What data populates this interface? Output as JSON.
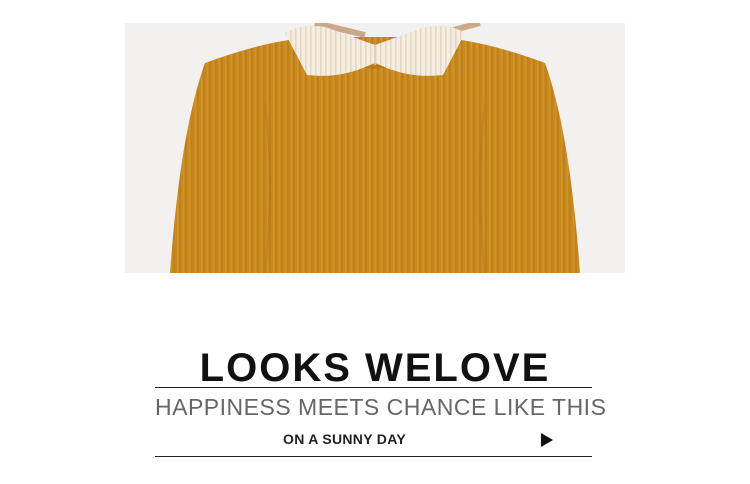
{
  "hero": {
    "image_alt": "mustard knit sweater with white collar on hanger",
    "colors": {
      "sweater": "#c98a1e",
      "collar": "#f4ede0",
      "background": "#f2f1ef"
    }
  },
  "banner": {
    "title": "LOOKS WELOVE",
    "subtitle": "HAPPINESS MEETS CHANCE LIKE THIS",
    "cta_label": "ON A SUNNY DAY",
    "cta_icon": "play-icon"
  }
}
